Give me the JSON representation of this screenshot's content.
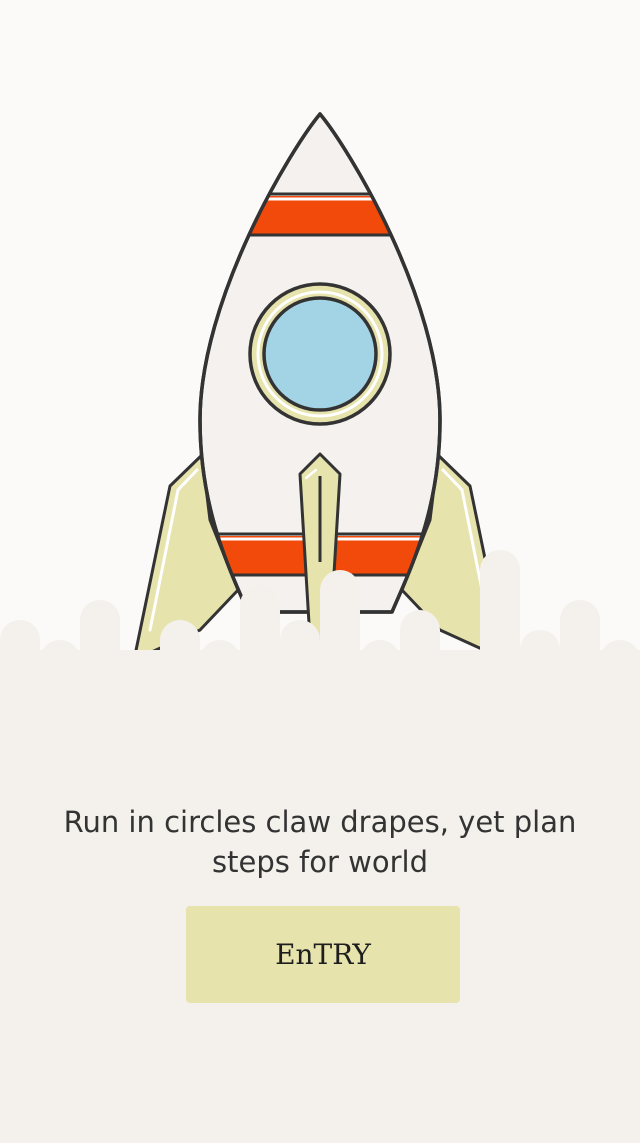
{
  "onboarding": {
    "tagline": "Run in circles claw drapes, yet plan steps for world",
    "entry_button_label": "EnTRY"
  },
  "colors": {
    "background_top": "#fbfaf8",
    "background_bottom": "#f4f0eb",
    "rocket_body": "#f4f1ee",
    "rocket_stripe": "#f24a0a",
    "rocket_fins": "#e6e3ad",
    "window_glass": "#a3d4e6",
    "outline": "#333333",
    "button_fill": "#e6e3ad"
  },
  "icons": {
    "illustration": "rocket-icon"
  }
}
